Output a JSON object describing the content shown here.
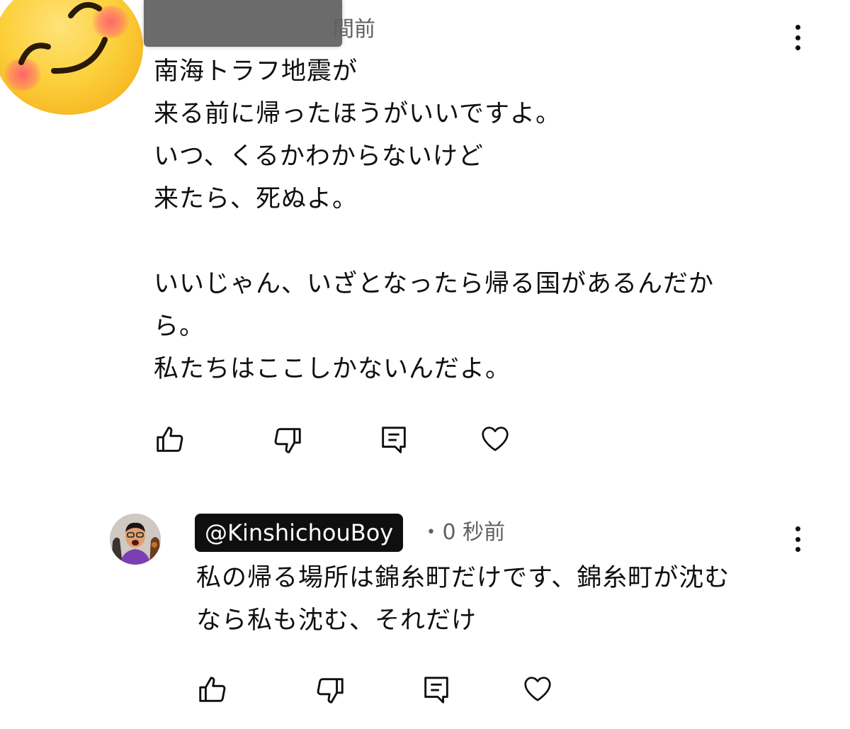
{
  "top_comment": {
    "time_fragment": "間前",
    "text": "南海トラフ地震が\n来る前に帰ったほうがいいですよ。\nいつ、くるかわからないけど\n来たら、死ぬよ。\n\nいいじゃん、いざとなったら帰る国があるんだか\nら。\n私たちはここしかないんだよ。",
    "avatar_icon": "smiling-face-emoji-icon",
    "actions": [
      "thumbs-up-icon",
      "thumbs-down-icon",
      "reply-icon",
      "heart-icon"
    ]
  },
  "reply": {
    "handle": "@KinshichouBoy",
    "separator": "•",
    "time": "0 秒前",
    "text": "私の帰る場所は錦糸町だけです、錦糸町が沈む\nなら私も沈む、それだけ",
    "actions": [
      "thumbs-up-icon",
      "thumbs-down-icon",
      "reply-icon",
      "heart-icon"
    ]
  },
  "colors": {
    "text": "#0f0f0f",
    "meta": "#606060",
    "chip_bg": "#0f0f0f",
    "chip_text": "#ffffff"
  }
}
